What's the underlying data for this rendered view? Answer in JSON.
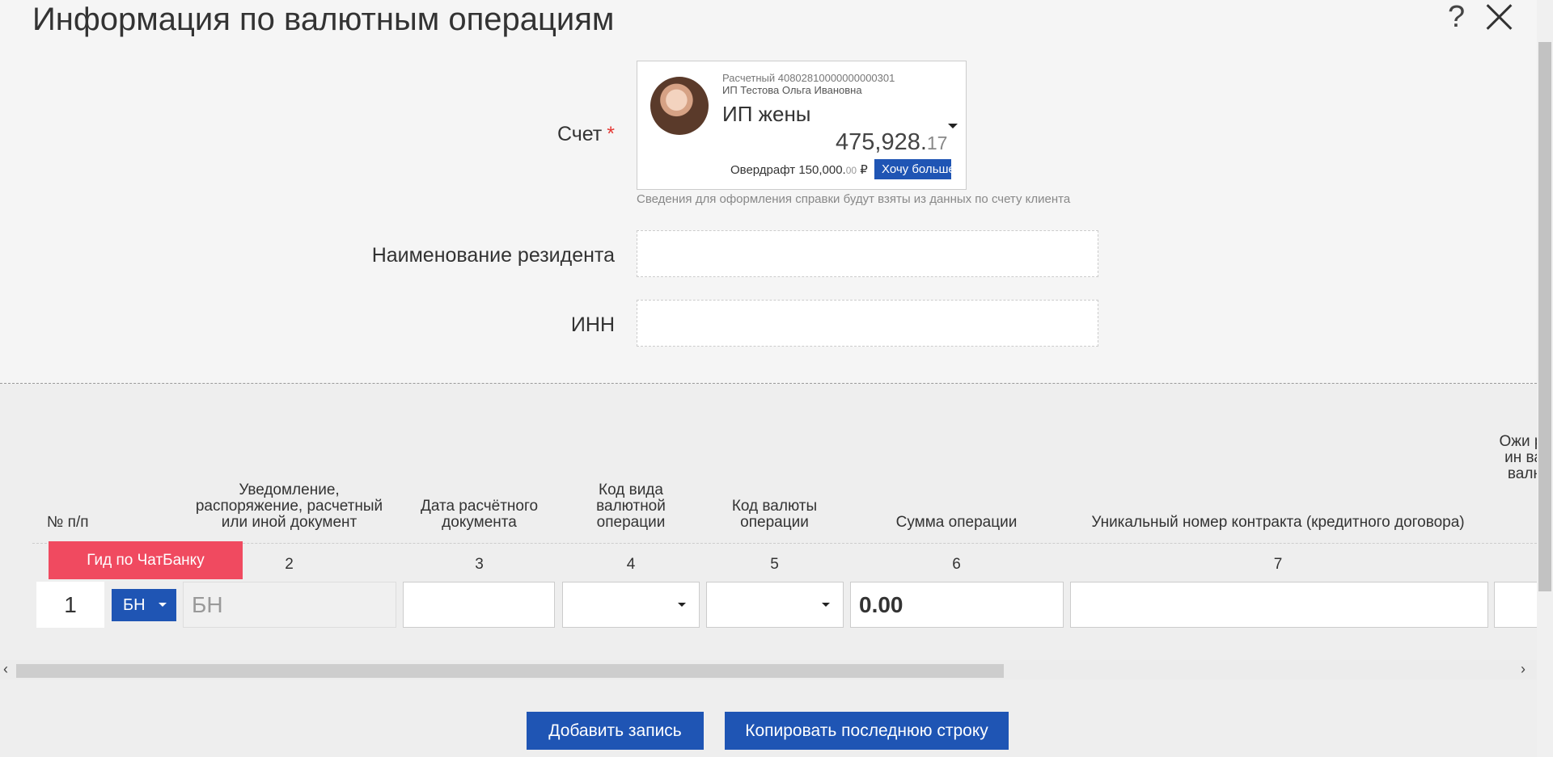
{
  "header": {
    "title": "Информация по валютным операциям",
    "help_label": "?"
  },
  "form": {
    "account": {
      "label": "Счет",
      "required_mark": "*",
      "line1": "Расчетный 40802810000000000301",
      "line2": "ИП Тестова Ольга Ивановна",
      "name": "ИП жены",
      "amount_main": "475,928.",
      "amount_cents": "17",
      "overdraft_label": "Овердрафт",
      "overdraft_main": "150,000.",
      "overdraft_cents": "00",
      "currency_symbol": "₽",
      "want_more_button": "Хочу больше",
      "hint": "Сведения для оформления справки будут взяты из данных по счету клиента"
    },
    "resident_name": {
      "label": "Наименование резидента",
      "value": ""
    },
    "inn": {
      "label": "ИНН",
      "value": ""
    }
  },
  "table": {
    "columns": [
      {
        "header": "№ п/п",
        "number": ""
      },
      {
        "header": "Уведомление, распоряжение, расчетный или иной документ",
        "number": "2"
      },
      {
        "header": "Дата расчётного документа",
        "number": "3"
      },
      {
        "header": "Код вида валютной операции",
        "number": "4"
      },
      {
        "header": "Код валюты операции",
        "number": "5"
      },
      {
        "header": "Сумма операции",
        "number": "6"
      },
      {
        "header": "Уникальный номер контракта (кредитного договора)",
        "number": "7"
      },
      {
        "header": "Ожи ре ин вал валют Ф",
        "number": ""
      }
    ],
    "row": {
      "number": "1",
      "doc_type_button": "БН",
      "doc_value": "БН",
      "date": "",
      "op_code": "",
      "currency_code": "",
      "sum": "0.00",
      "contract": ""
    }
  },
  "guide_button": "Гид по ЧатБанку",
  "actions": {
    "add": "Добавить запись",
    "copy_last": "Копировать последнюю строку"
  },
  "colors": {
    "accent": "#1f55b4",
    "guide": "#f04a60",
    "required": "#e53935"
  }
}
